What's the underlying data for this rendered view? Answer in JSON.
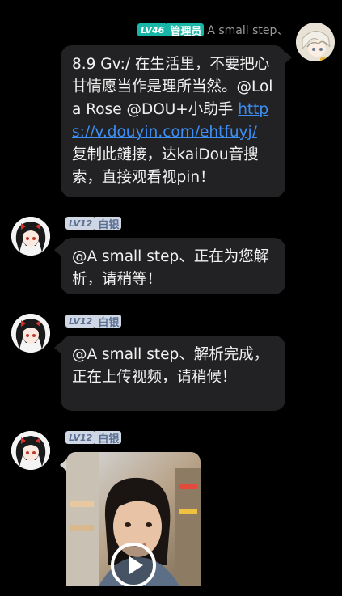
{
  "messages": [
    {
      "level_label": "LV46",
      "role_label": "管理员",
      "username": "A small step、",
      "text_parts": {
        "pre": "8.9 Gv:/ 在生活里，不要把心甘情愿当作是理所当然。@Lola Rose @DOU+小助手 ",
        "link": "https://v.douyin.com/ehtfuyj/",
        "post": " 复制此鏈接，达kaiDou音搜索，直接观看视pin！"
      }
    },
    {
      "level_label": "LV12",
      "role_label": "白银",
      "text": "@A small step、正在为您解析，请稍等！"
    },
    {
      "level_label": "LV12",
      "role_label": "白银",
      "text": "@A small step、解析完成，正在上传视频，请稍候！"
    },
    {
      "level_label": "LV12",
      "role_label": "白银",
      "video": {
        "play_icon": "play-icon"
      }
    }
  ],
  "colors": {
    "background": "#000000",
    "bubble": "#222224",
    "link": "#3d8ff5",
    "admin_badge": "#18b6a6",
    "silver_badge": "#cfd7e4"
  }
}
